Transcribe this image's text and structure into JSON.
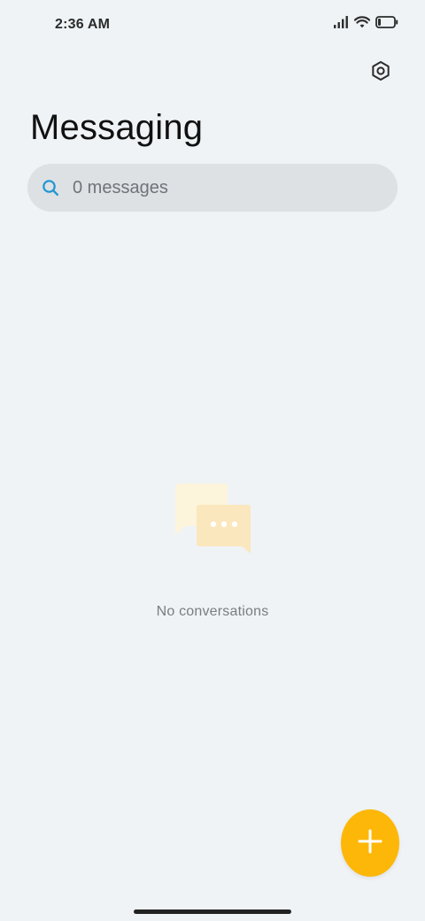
{
  "status_bar": {
    "time": "2:36 AM",
    "icons": [
      "signal-icon",
      "wifi-icon",
      "battery-icon"
    ]
  },
  "header": {
    "title": "Messaging",
    "settings_icon": "settings-icon"
  },
  "search": {
    "icon": "search-icon",
    "text": "0 messages"
  },
  "empty_state": {
    "icon": "chat-bubbles-icon",
    "text": "No conversations"
  },
  "fab": {
    "icon": "plus-icon"
  },
  "colors": {
    "background": "#eff3f6",
    "search_background": "#dde1e4",
    "accent": "#fdb708",
    "search_icon": "#2196d3"
  }
}
